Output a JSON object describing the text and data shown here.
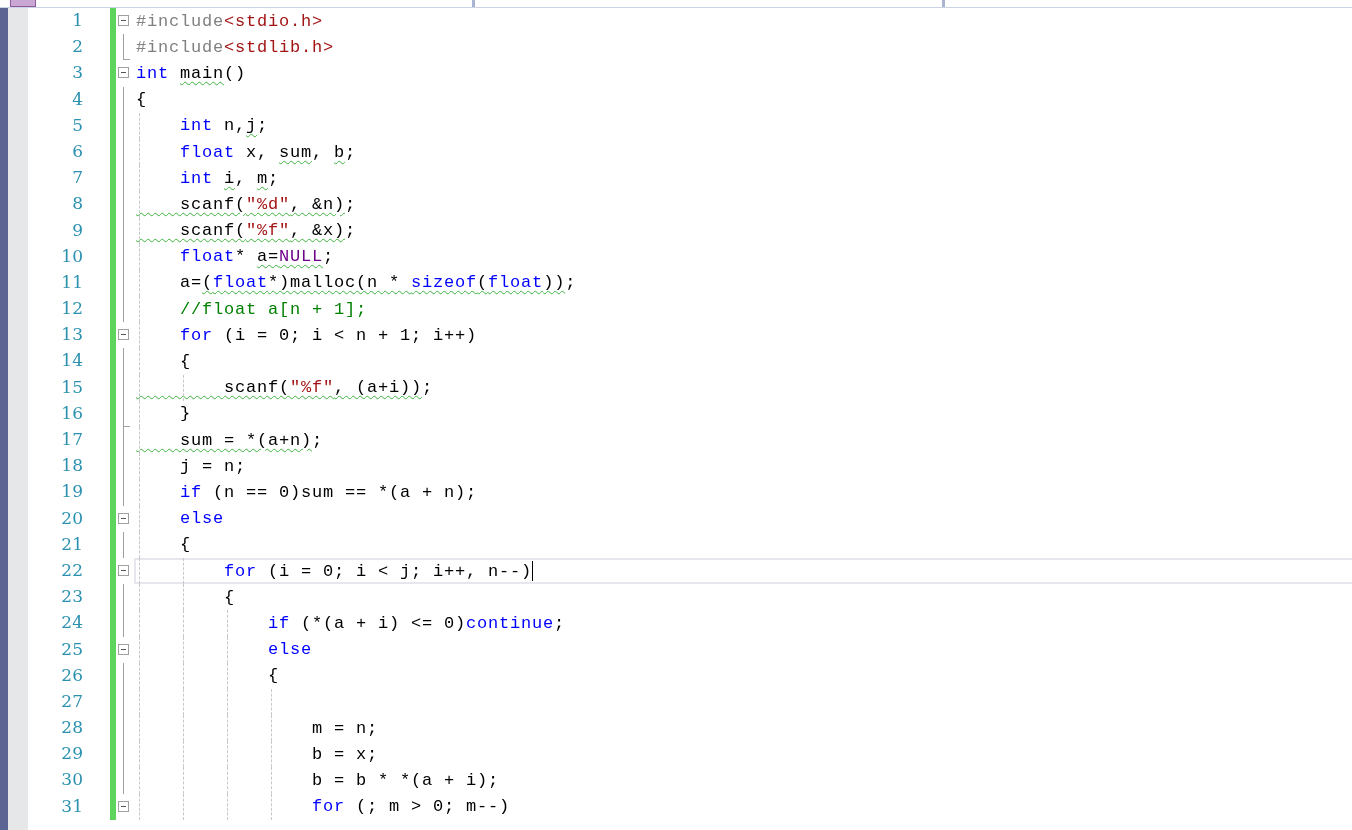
{
  "editor": {
    "lines": [
      {
        "number": "1",
        "changed": true,
        "collapsible": true,
        "block_end": false,
        "current": false,
        "tokens": [
          {
            "kind": "pre",
            "text": "#include"
          },
          {
            "kind": "str",
            "text": "<stdio.h>"
          }
        ]
      },
      {
        "number": "2",
        "changed": true,
        "collapsible": false,
        "block_end": true,
        "current": false,
        "tokens": [
          {
            "kind": "pre",
            "text": "#include"
          },
          {
            "kind": "str",
            "text": "<stdlib.h>"
          }
        ]
      },
      {
        "number": "3",
        "changed": true,
        "collapsible": true,
        "block_end": false,
        "current": false,
        "tokens": [
          {
            "kind": "kw",
            "text": "int "
          },
          {
            "kind": "plain",
            "text": "main",
            "squiggle": true
          },
          {
            "kind": "plain",
            "text": "()"
          }
        ]
      },
      {
        "number": "4",
        "changed": true,
        "collapsible": false,
        "block_end": false,
        "current": false,
        "tokens": [
          {
            "kind": "plain",
            "text": "{"
          }
        ]
      },
      {
        "number": "5",
        "changed": true,
        "collapsible": false,
        "block_end": false,
        "current": false,
        "tokens": [
          {
            "kind": "kw",
            "text": "    int"
          },
          {
            "kind": "plain",
            "text": " n,"
          },
          {
            "kind": "plain",
            "text": "j",
            "squiggle": true
          },
          {
            "kind": "plain",
            "text": ";"
          }
        ]
      },
      {
        "number": "6",
        "changed": true,
        "collapsible": false,
        "block_end": false,
        "current": false,
        "tokens": [
          {
            "kind": "kw",
            "text": "    float"
          },
          {
            "kind": "plain",
            "text": " x, "
          },
          {
            "kind": "plain",
            "text": "sum",
            "squiggle": true
          },
          {
            "kind": "plain",
            "text": ", "
          },
          {
            "kind": "plain",
            "text": "b",
            "squiggle": true
          },
          {
            "kind": "plain",
            "text": ";"
          }
        ]
      },
      {
        "number": "7",
        "changed": true,
        "collapsible": false,
        "block_end": false,
        "current": false,
        "tokens": [
          {
            "kind": "kw",
            "text": "    int "
          },
          {
            "kind": "plain",
            "text": "i",
            "squiggle": true
          },
          {
            "kind": "plain",
            "text": ", "
          },
          {
            "kind": "plain",
            "text": "m",
            "squiggle": true
          },
          {
            "kind": "plain",
            "text": ";"
          }
        ]
      },
      {
        "number": "8",
        "changed": true,
        "collapsible": false,
        "block_end": false,
        "current": false,
        "tokens": [
          {
            "kind": "plain",
            "text": "    scanf(",
            "squiggle": true
          },
          {
            "kind": "str",
            "text": "\"%d\"",
            "squiggle": true
          },
          {
            "kind": "plain",
            "text": ", &n)",
            "squiggle": true
          },
          {
            "kind": "plain",
            "text": ";"
          }
        ]
      },
      {
        "number": "9",
        "changed": true,
        "collapsible": false,
        "block_end": false,
        "current": false,
        "tokens": [
          {
            "kind": "plain",
            "text": "    scanf(",
            "squiggle": true
          },
          {
            "kind": "str",
            "text": "\"%f\"",
            "squiggle": true
          },
          {
            "kind": "plain",
            "text": ", &x)",
            "squiggle": true
          },
          {
            "kind": "plain",
            "text": ";"
          }
        ]
      },
      {
        "number": "10",
        "changed": true,
        "collapsible": false,
        "block_end": false,
        "current": false,
        "tokens": [
          {
            "kind": "kw",
            "text": "    float"
          },
          {
            "kind": "plain",
            "text": "* "
          },
          {
            "kind": "plain",
            "text": "a=",
            "squiggle": true
          },
          {
            "kind": "macro",
            "text": "NULL",
            "squiggle": true
          },
          {
            "kind": "plain",
            "text": ";"
          }
        ]
      },
      {
        "number": "11",
        "changed": true,
        "collapsible": false,
        "block_end": false,
        "current": false,
        "tokens": [
          {
            "kind": "plain",
            "text": "    a="
          },
          {
            "kind": "plain",
            "text": "(",
            "squiggle": true
          },
          {
            "kind": "kw",
            "text": "float",
            "squiggle": true
          },
          {
            "kind": "plain",
            "text": "*)malloc(n * ",
            "squiggle": true
          },
          {
            "kind": "kw",
            "text": "sizeof",
            "squiggle": true
          },
          {
            "kind": "plain",
            "text": "(",
            "squiggle": true
          },
          {
            "kind": "kw",
            "text": "float",
            "squiggle": true
          },
          {
            "kind": "plain",
            "text": "))",
            "squiggle": true
          },
          {
            "kind": "plain",
            "text": ";"
          }
        ]
      },
      {
        "number": "12",
        "changed": true,
        "collapsible": false,
        "block_end": false,
        "current": false,
        "tokens": [
          {
            "kind": "comment",
            "text": "    //float a[n + 1];"
          }
        ]
      },
      {
        "number": "13",
        "changed": true,
        "collapsible": true,
        "block_end": false,
        "current": false,
        "tokens": [
          {
            "kind": "kw",
            "text": "    for"
          },
          {
            "kind": "plain",
            "text": " (i = 0; i < n + 1; i++)"
          }
        ]
      },
      {
        "number": "14",
        "changed": true,
        "collapsible": false,
        "block_end": false,
        "current": false,
        "tokens": [
          {
            "kind": "plain",
            "text": "    {"
          }
        ]
      },
      {
        "number": "15",
        "changed": true,
        "collapsible": false,
        "block_end": false,
        "current": false,
        "tokens": [
          {
            "kind": "plain",
            "text": "        scanf(",
            "squiggle": true
          },
          {
            "kind": "str",
            "text": "\"%f\"",
            "squiggle": true
          },
          {
            "kind": "plain",
            "text": ", (a+i))",
            "squiggle": true
          },
          {
            "kind": "plain",
            "text": ";"
          }
        ]
      },
      {
        "number": "16",
        "changed": true,
        "collapsible": false,
        "block_end": true,
        "current": false,
        "tokens": [
          {
            "kind": "plain",
            "text": "    }"
          }
        ]
      },
      {
        "number": "17",
        "changed": true,
        "collapsible": false,
        "block_end": false,
        "current": false,
        "tokens": [
          {
            "kind": "plain",
            "text": "    sum = *(a+n)",
            "squiggle": true
          },
          {
            "kind": "plain",
            "text": ";"
          }
        ]
      },
      {
        "number": "18",
        "changed": true,
        "collapsible": false,
        "block_end": false,
        "current": false,
        "tokens": [
          {
            "kind": "plain",
            "text": "    j = n;"
          }
        ]
      },
      {
        "number": "19",
        "changed": true,
        "collapsible": false,
        "block_end": false,
        "current": false,
        "tokens": [
          {
            "kind": "kw",
            "text": "    if"
          },
          {
            "kind": "plain",
            "text": " (n == 0)sum == *(a + n);"
          }
        ]
      },
      {
        "number": "20",
        "changed": true,
        "collapsible": true,
        "block_end": false,
        "current": false,
        "tokens": [
          {
            "kind": "kw",
            "text": "    else"
          }
        ]
      },
      {
        "number": "21",
        "changed": true,
        "collapsible": false,
        "block_end": false,
        "current": false,
        "tokens": [
          {
            "kind": "plain",
            "text": "    {"
          }
        ]
      },
      {
        "number": "22",
        "changed": true,
        "collapsible": true,
        "block_end": false,
        "current": true,
        "tokens": [
          {
            "kind": "kw",
            "text": "        for"
          },
          {
            "kind": "plain",
            "text": " (i = 0; i < j; i++, n--)"
          }
        ]
      },
      {
        "number": "23",
        "changed": true,
        "collapsible": false,
        "block_end": false,
        "current": false,
        "tokens": [
          {
            "kind": "plain",
            "text": "        {"
          }
        ]
      },
      {
        "number": "24",
        "changed": true,
        "collapsible": false,
        "block_end": false,
        "current": false,
        "tokens": [
          {
            "kind": "kw",
            "text": "            if"
          },
          {
            "kind": "plain",
            "text": " (*(a + i) <= 0)"
          },
          {
            "kind": "kw",
            "text": "continue"
          },
          {
            "kind": "plain",
            "text": ";"
          }
        ]
      },
      {
        "number": "25",
        "changed": true,
        "collapsible": true,
        "block_end": false,
        "current": false,
        "tokens": [
          {
            "kind": "kw",
            "text": "            else"
          }
        ]
      },
      {
        "number": "26",
        "changed": true,
        "collapsible": false,
        "block_end": false,
        "current": false,
        "tokens": [
          {
            "kind": "plain",
            "text": "            {"
          }
        ]
      },
      {
        "number": "27",
        "changed": true,
        "collapsible": false,
        "block_end": false,
        "current": false
      },
      {
        "number": "28",
        "changed": true,
        "collapsible": false,
        "block_end": false,
        "current": false,
        "tokens": [
          {
            "kind": "plain",
            "text": "                m = n;"
          }
        ]
      },
      {
        "number": "29",
        "changed": true,
        "collapsible": false,
        "block_end": false,
        "current": false,
        "tokens": [
          {
            "kind": "plain",
            "text": "                b = x;"
          }
        ]
      },
      {
        "number": "30",
        "changed": true,
        "collapsible": false,
        "block_end": false,
        "current": false,
        "tokens": [
          {
            "kind": "plain",
            "text": "                b = b * *(a + i);"
          }
        ]
      },
      {
        "number": "31",
        "changed": true,
        "collapsible": true,
        "block_end": false,
        "current": false,
        "tokens": [
          {
            "kind": "kw",
            "text": "                for"
          },
          {
            "kind": "plain",
            "text": " (; m > 0; m--)"
          }
        ]
      }
    ]
  }
}
